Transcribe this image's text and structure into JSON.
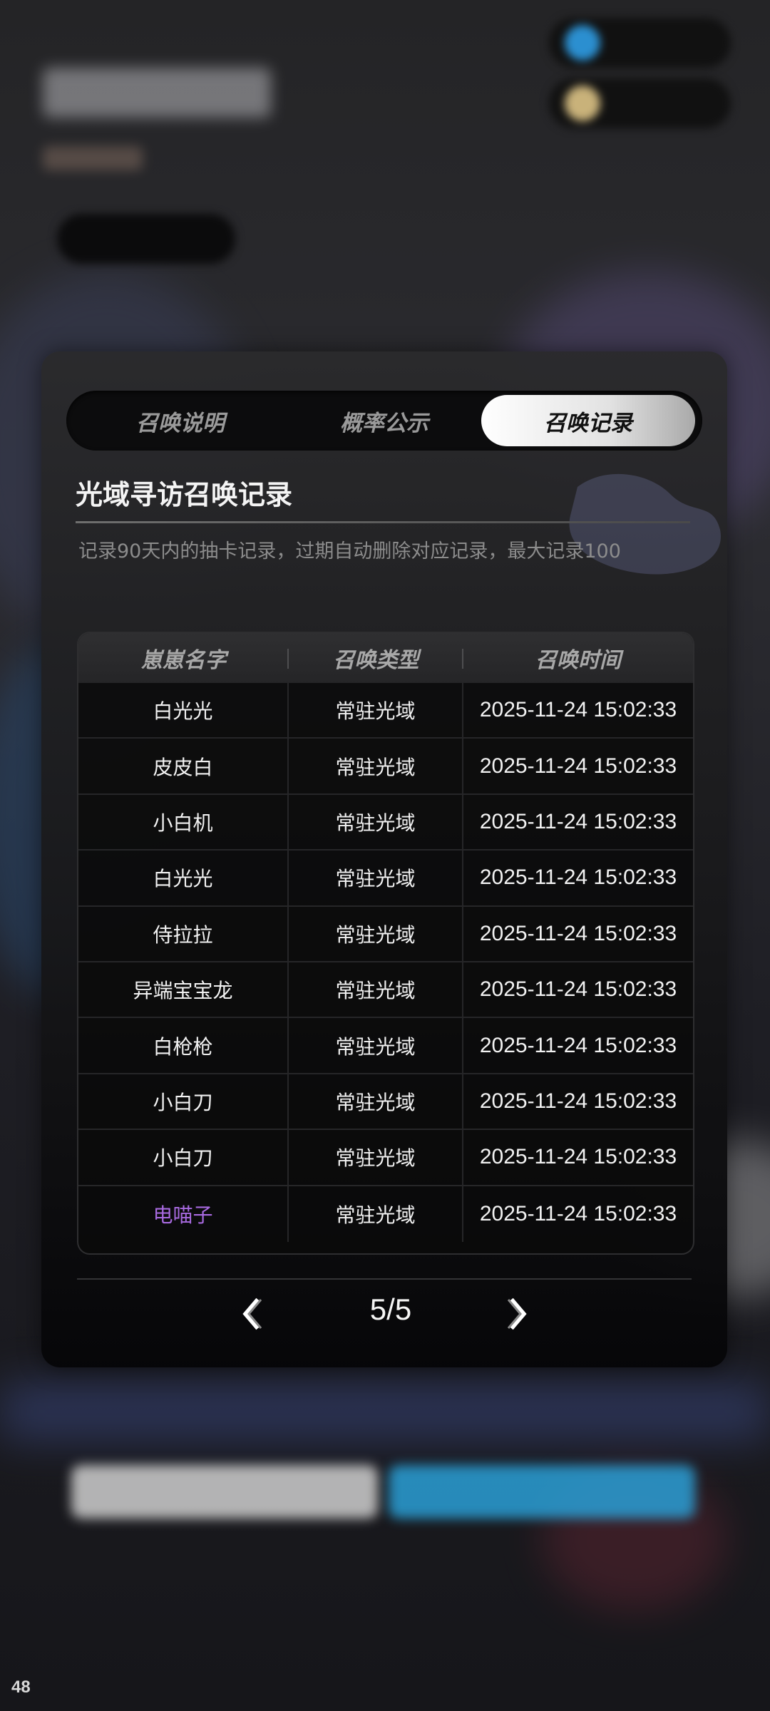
{
  "tabs": [
    {
      "label": "召唤说明",
      "active": false
    },
    {
      "label": "概率公示",
      "active": false
    },
    {
      "label": "召唤记录",
      "active": true
    }
  ],
  "record": {
    "title": "光域寻访召唤记录",
    "description": "记录90天内的抽卡记录，过期自动删除对应记录，最大记录100"
  },
  "table": {
    "headers": [
      "崽崽名字",
      "召唤类型",
      "召唤时间"
    ],
    "rows": [
      {
        "name": "白光光",
        "type": "常驻光域",
        "time": "2025-11-24 15:02:33"
      },
      {
        "name": "皮皮白",
        "type": "常驻光域",
        "time": "2025-11-24 15:02:33"
      },
      {
        "name": "小白机",
        "type": "常驻光域",
        "time": "2025-11-24 15:02:33"
      },
      {
        "name": "白光光",
        "type": "常驻光域",
        "time": "2025-11-24 15:02:33"
      },
      {
        "name": "侍拉拉",
        "type": "常驻光域",
        "time": "2025-11-24 15:02:33"
      },
      {
        "name": "异端宝宝龙",
        "type": "常驻光域",
        "time": "2025-11-24 15:02:33"
      },
      {
        "name": "白枪枪",
        "type": "常驻光域",
        "time": "2025-11-24 15:02:33"
      },
      {
        "name": "小白刀",
        "type": "常驻光域",
        "time": "2025-11-24 15:02:33"
      },
      {
        "name": "小白刀",
        "type": "常驻光域",
        "time": "2025-11-24 15:02:33"
      },
      {
        "name": "电喵子",
        "type": "常驻光域",
        "time": "2025-11-24 15:02:33",
        "highlight": "#a86ae0"
      }
    ]
  },
  "pagination": {
    "text": "5/5"
  },
  "fps": "48",
  "icons": {
    "prev": "chevron-left-icon",
    "next": "chevron-right-icon"
  }
}
